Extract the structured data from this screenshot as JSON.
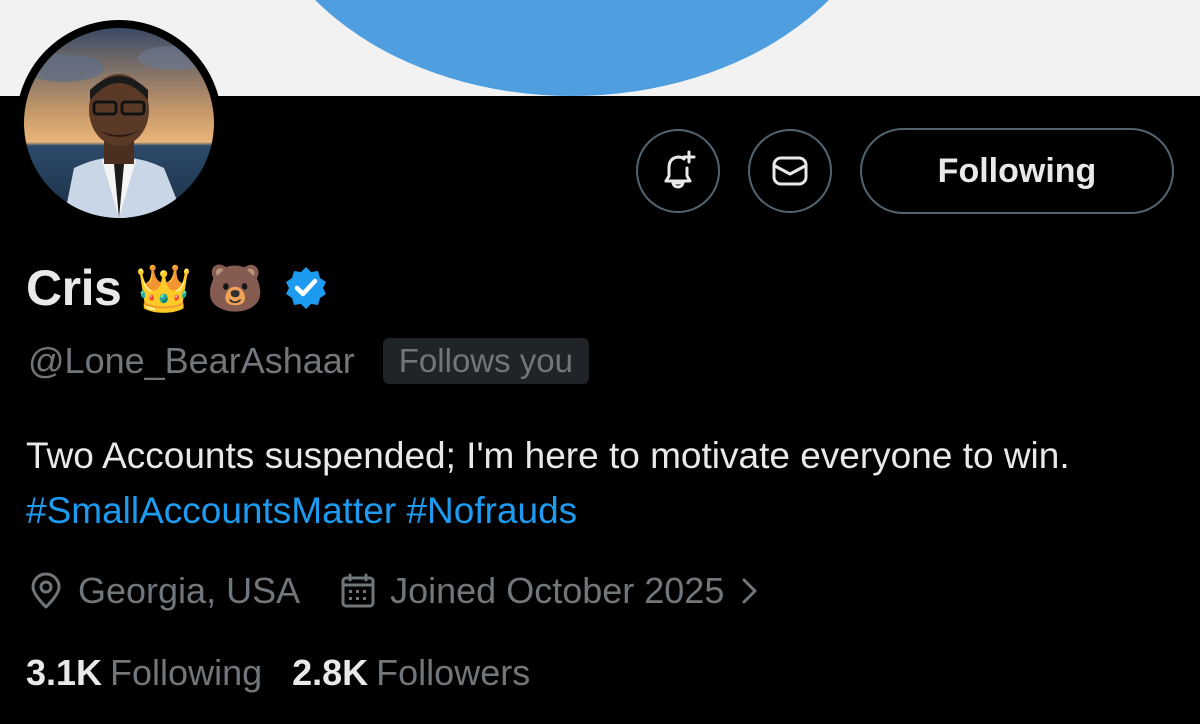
{
  "profile": {
    "display_name": "Cris",
    "name_emojis": [
      "👑",
      "🐻"
    ],
    "handle": "@Lone_BearAshaar",
    "follows_you_badge": "Follows you",
    "verified": true
  },
  "actions": {
    "notify_icon": "bell-plus-icon",
    "message_icon": "envelope-icon",
    "follow_label": "Following"
  },
  "bio": {
    "text": "Two Accounts suspended; I'm here to motivate everyone to win.",
    "hashtags": [
      "#SmallAccountsMatter",
      "#Nofrauds"
    ]
  },
  "meta": {
    "location": "Georgia, USA",
    "joined": "Joined October 2025"
  },
  "stats": {
    "following_count": "3.1K",
    "following_label": "Following",
    "followers_count": "2.8K",
    "followers_label": "Followers"
  },
  "colors": {
    "background": "#000000",
    "text_primary": "#e7e9ea",
    "text_secondary": "#71767b",
    "accent": "#1d9bf0",
    "border": "#536471",
    "banner_shape": "#4e9ee0"
  }
}
